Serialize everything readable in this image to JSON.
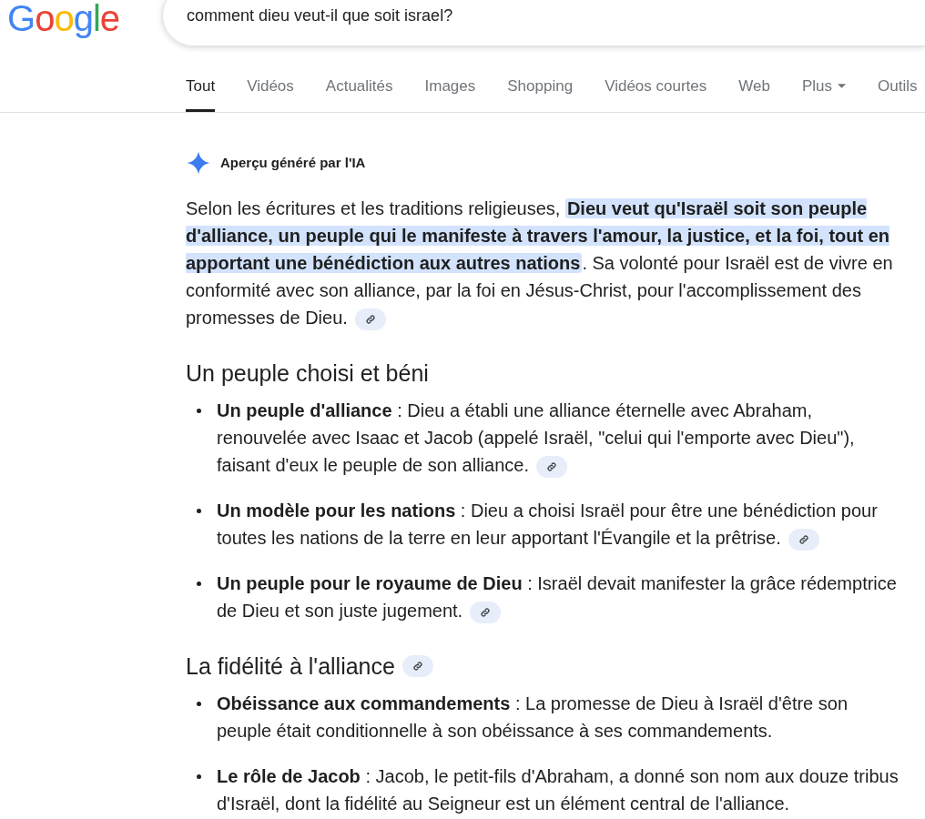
{
  "logo": "Google",
  "search": {
    "value": "comment dieu veut-il que soit israel?"
  },
  "tabs": [
    {
      "label": "Tout",
      "selected": true,
      "dropdown": false
    },
    {
      "label": "Vidéos",
      "selected": false,
      "dropdown": false
    },
    {
      "label": "Actualités",
      "selected": false,
      "dropdown": false
    },
    {
      "label": "Images",
      "selected": false,
      "dropdown": false
    },
    {
      "label": "Shopping",
      "selected": false,
      "dropdown": false
    },
    {
      "label": "Vidéos courtes",
      "selected": false,
      "dropdown": false
    },
    {
      "label": "Web",
      "selected": false,
      "dropdown": false
    },
    {
      "label": "Plus",
      "selected": false,
      "dropdown": true
    },
    {
      "label": "Outils",
      "selected": false,
      "dropdown": false
    }
  ],
  "ai_overview": {
    "title": "Aperçu généré par l'IA",
    "intro": {
      "before": "Selon les écritures et les traditions religieuses, ",
      "highlight": "Dieu veut qu'Israël soit son peuple d'alliance, un peuple qui le manifeste à travers l'amour, la justice, et la foi, tout en apportant une bénédiction aux autres nations",
      "after": ". Sa volonté pour Israël est de vivre en conformité avec son alliance, par la foi en Jésus-Christ, pour l'accomplissement des promesses de Dieu.",
      "has_link": true
    },
    "sections": [
      {
        "heading": "Un peuple choisi et béni",
        "has_link": false,
        "items": [
          {
            "text": "**Un peuple d'alliance** : Dieu a établi une alliance éternelle avec Abraham, renouvelée avec Isaac et Jacob (appelé Israël, \"celui qui l'emporte avec Dieu\"), faisant d'eux le peuple de son alliance.",
            "has_link": true
          },
          {
            "text": "**Un modèle pour les nations** : Dieu a choisi Israël pour être une bénédiction pour toutes les nations de la terre en leur apportant l'Évangile et la prêtrise.",
            "has_link": true
          },
          {
            "text": "**Un peuple pour le royaume de Dieu** : Israël devait manifester la grâce rédemptrice de Dieu et son juste jugement.",
            "has_link": true
          }
        ]
      },
      {
        "heading": "La fidélité à l'alliance",
        "has_link": true,
        "items": [
          {
            "text": "**Obéissance aux commandements** : La promesse de Dieu à Israël d'être son peuple était conditionnelle à son obéissance à ses commandements.",
            "has_link": false
          },
          {
            "text": "**Le rôle de Jacob** : Jacob, le petit-fils d'Abraham, a donné son nom aux douze tribus d'Israël, dont la fidélité au Seigneur est un élément central de l'alliance.",
            "has_link": false
          }
        ]
      }
    ]
  }
}
